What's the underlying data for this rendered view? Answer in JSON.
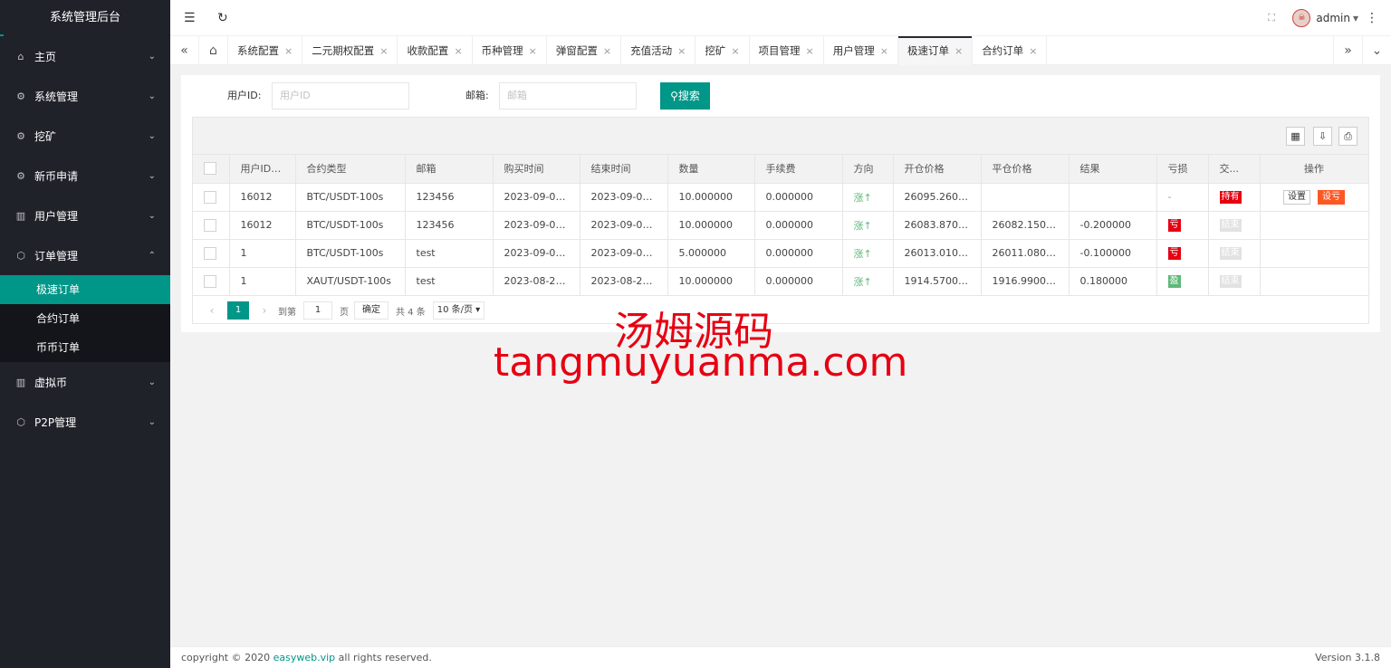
{
  "app": {
    "title": "系统管理后台"
  },
  "sidebar": {
    "items": [
      {
        "label": "主页",
        "icon": "home-icon",
        "glyph": "⌂",
        "chev": "⌄"
      },
      {
        "label": "系统管理",
        "icon": "gear-icon",
        "glyph": "⚙",
        "chev": "⌄"
      },
      {
        "label": "挖矿",
        "icon": "gear-icon",
        "glyph": "⚙",
        "chev": "⌄"
      },
      {
        "label": "新币申请",
        "icon": "gear-icon",
        "glyph": "⚙",
        "chev": "⌄"
      },
      {
        "label": "用户管理",
        "icon": "list-icon",
        "glyph": "▥",
        "chev": "⌄"
      },
      {
        "label": "订单管理",
        "icon": "cube-icon",
        "glyph": "⬡",
        "chev": "⌃"
      },
      {
        "label": "虚拟币",
        "icon": "list-icon",
        "glyph": "▥",
        "chev": "⌄"
      },
      {
        "label": "P2P管理",
        "icon": "cube-icon",
        "glyph": "⬡",
        "chev": "⌄"
      }
    ],
    "subitems": [
      "极速订单",
      "合约订单",
      "币币订单"
    ]
  },
  "header": {
    "user": "admin",
    "menu_glyph": "☰",
    "refresh_glyph": "↻",
    "fullscreen_glyph": "⛶",
    "more_glyph": "⋮",
    "caret": "▾"
  },
  "tabs": {
    "home_glyph": "⌂",
    "prev_glyph": "«",
    "next_glyph": "»",
    "down_glyph": "⌄",
    "close_glyph": "×",
    "items": [
      "系统配置",
      "二元期权配置",
      "收款配置",
      "币种管理",
      "弹窗配置",
      "充值活动",
      "挖矿",
      "项目管理",
      "用户管理",
      "极速订单",
      "合约订单"
    ],
    "active_index": 9
  },
  "search": {
    "userid_label": "用户ID:",
    "userid_placeholder": "用户ID",
    "email_label": "邮箱:",
    "email_placeholder": "邮箱",
    "button": "搜索",
    "button_glyph": "⚲"
  },
  "table": {
    "columns": [
      "用户ID",
      "合约类型",
      "邮箱",
      "购买时间",
      "结束时间",
      "数量",
      "手续费",
      "方向",
      "开仓价格",
      "平仓价格",
      "结果",
      "亏损",
      "交...",
      "操作"
    ],
    "sort_glyph": "⇕",
    "rows": [
      {
        "uid": "16012",
        "type": "BTC/USDT-100s",
        "email": "123456",
        "buy": "2023-09-01 ...",
        "end": "2023-09-01 ...",
        "qty": "10.000000",
        "fee": "0.000000",
        "dir": "涨↑",
        "open": "26095.260000",
        "close": "",
        "result": "",
        "loss": "-",
        "status": "持有",
        "status_style": "red",
        "ops": [
          "设置",
          "设亏"
        ]
      },
      {
        "uid": "16012",
        "type": "BTC/USDT-100s",
        "email": "123456",
        "buy": "2023-09-01 ...",
        "end": "2023-09-01 ...",
        "qty": "10.000000",
        "fee": "0.000000",
        "dir": "涨↑",
        "open": "26083.870000",
        "close": "26082.150000",
        "result": "-0.200000",
        "loss": "亏",
        "loss_style": "red",
        "status": "结束",
        "status_style": "gray",
        "ops": []
      },
      {
        "uid": "1",
        "type": "BTC/USDT-100s",
        "email": "test",
        "buy": "2023-09-01 ...",
        "end": "2023-09-01 ...",
        "qty": "5.000000",
        "fee": "0.000000",
        "dir": "涨↑",
        "open": "26013.010000",
        "close": "26011.080000",
        "result": "-0.100000",
        "loss": "亏",
        "loss_style": "red",
        "status": "结束",
        "status_style": "gray",
        "ops": []
      },
      {
        "uid": "1",
        "type": "XAUT/USDT-100s",
        "email": "test",
        "buy": "2023-08-28 ...",
        "end": "2023-08-28 ...",
        "qty": "10.000000",
        "fee": "0.000000",
        "dir": "涨↑",
        "open": "1914.570000",
        "close": "1916.990000",
        "result": "0.180000",
        "loss": "盈",
        "loss_style": "green",
        "status": "结束",
        "status_style": "gray",
        "ops": []
      }
    ],
    "tools": [
      "▦",
      "⇩",
      "⎙"
    ]
  },
  "pager": {
    "prev": "‹",
    "next": "›",
    "current": "1",
    "goto_label": "到第",
    "goto_value": "1",
    "page_suffix": "页",
    "confirm": "确定",
    "total": "共 4 条",
    "per_page": "10 条/页 ▾"
  },
  "watermark": {
    "line1": "汤姆源码",
    "line2": "tangmuyuanma.com"
  },
  "footer": {
    "copyright": "copyright © 2020 ",
    "link": "easyweb.vip",
    "rights": " all rights reserved.",
    "version": "Version 3.1.8"
  },
  "colors": {
    "accent": "#009688",
    "sidebar": "#20222a",
    "danger": "#e60012",
    "warn": "#ff5722",
    "up": "#5fb878"
  }
}
